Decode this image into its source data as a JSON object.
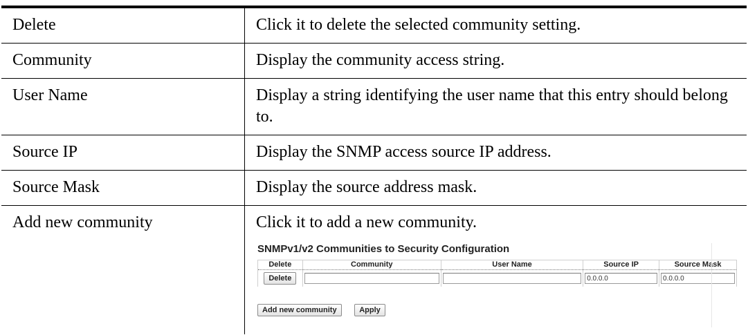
{
  "rows": [
    {
      "label": "Delete",
      "description": "Click it to delete the selected community setting."
    },
    {
      "label": "Community",
      "description": "Display the community access string."
    },
    {
      "label": "User Name",
      "description": "Display a string identifying the user name that this entry should belong to."
    },
    {
      "label": "Source IP",
      "description": "Display the SNMP access source IP address."
    },
    {
      "label": "Source Mask",
      "description": "Display the source address mask."
    },
    {
      "label": "Add new community",
      "description": "Click it to add a new community."
    }
  ],
  "screenshot": {
    "title": "SNMPv1/v2 Communities to Security Configuration",
    "columns": [
      "Delete",
      "Community",
      "User Name",
      "Source IP",
      "Source Mask"
    ],
    "row": {
      "delete_button": "Delete",
      "community_value": "",
      "user_name_value": "",
      "source_ip_value": "0.0.0.0",
      "source_mask_value": "0.0.0.0"
    },
    "add_button": "Add new community",
    "apply_button": "Apply"
  }
}
